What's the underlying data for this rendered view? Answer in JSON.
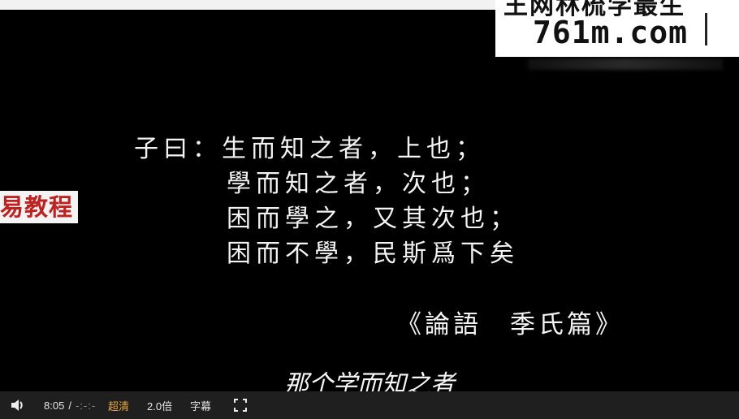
{
  "watermark": {
    "partial_text": "王网林梳学最生",
    "url": "761m.com"
  },
  "side_badge": {
    "text": "易教程"
  },
  "slide": {
    "lines": [
      "子曰：生而知之者，上也；",
      "學而知之者，次也；",
      "困而學之，又其次也；",
      "困而不學，民斯爲下矣"
    ],
    "source": "《論語　季氏篇》"
  },
  "subtitle": "那个学而知之者",
  "player": {
    "current_time": "8:05",
    "separator": "/",
    "duration": "-:-:-",
    "quality": "超清",
    "speed": "2.0倍",
    "subtitles": "字幕",
    "icons": {
      "volume": "volume-icon",
      "fullscreen": "fullscreen-icon"
    },
    "accent_color": "#e7a63b"
  }
}
